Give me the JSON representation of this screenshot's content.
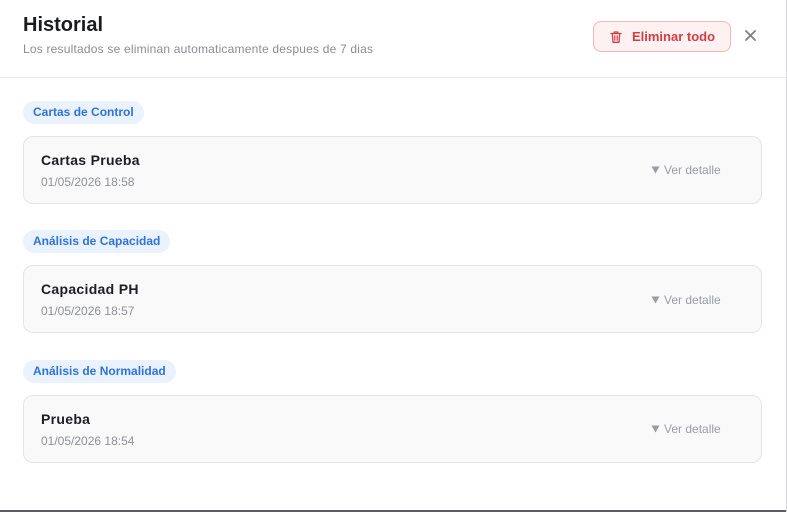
{
  "header": {
    "title": "Historial",
    "subtitle": "Los resultados se eliminan automaticamente despues de 7 dias",
    "clear_all_label": "Eliminar todo"
  },
  "groups": [
    {
      "category": "Cartas de Control",
      "items": [
        {
          "name": "Cartas Prueba",
          "date": "01/05/2026 18:58",
          "detail_label": "Ver detalle"
        }
      ]
    },
    {
      "category": "Análisis de Capacidad",
      "items": [
        {
          "name": "Capacidad PH",
          "date": "01/05/2026 18:57",
          "detail_label": "Ver detalle"
        }
      ]
    },
    {
      "category": "Análisis de Normalidad",
      "items": [
        {
          "name": "Prueba",
          "date": "01/05/2026 18:54",
          "detail_label": "Ver detalle"
        }
      ]
    }
  ],
  "icons": {
    "clear": "trash-icon",
    "close": "close-icon",
    "expand": "caret-down-icon"
  },
  "colors": {
    "accent": "#2f73d8",
    "danger": "#d43d44",
    "danger_bg": "#fdf1f1",
    "chip_bg": "#eaf2fe"
  }
}
